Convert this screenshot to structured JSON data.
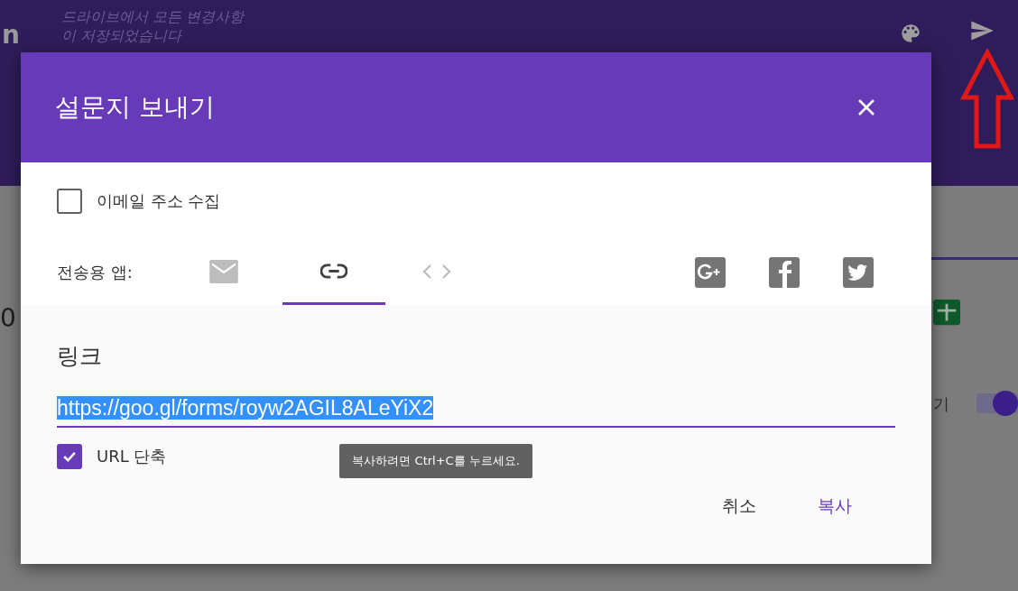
{
  "background": {
    "app_title_fragment": "n",
    "save_status": [
      "드라이브에서 모든 변경사항",
      "이 저장되었습니다"
    ],
    "side_number": "0",
    "side_label_fragment": "기",
    "toggle": {
      "on": true
    }
  },
  "dialog": {
    "title": "설문지 보내기",
    "collect_email": {
      "label": "이메일 주소 수집",
      "checked": false
    },
    "send_via": {
      "label": "전송용 앱:",
      "tabs": [
        {
          "kind": "email",
          "selected": false
        },
        {
          "kind": "link",
          "selected": true
        },
        {
          "kind": "embed",
          "selected": false
        }
      ],
      "social": [
        {
          "kind": "google_plus"
        },
        {
          "kind": "facebook"
        },
        {
          "kind": "twitter"
        }
      ]
    },
    "link": {
      "heading": "링크",
      "url": "https://goo.gl/forms/royw2AGIL8ALeYiX2",
      "text_selected": true,
      "shorten_url": {
        "label": "URL 단축",
        "checked": true
      },
      "tooltip": "복사하려면 Ctrl+C를 누르세요."
    },
    "buttons": [
      {
        "label": "취소",
        "kind": "cancel"
      },
      {
        "label": "복사",
        "kind": "primary"
      }
    ]
  }
}
